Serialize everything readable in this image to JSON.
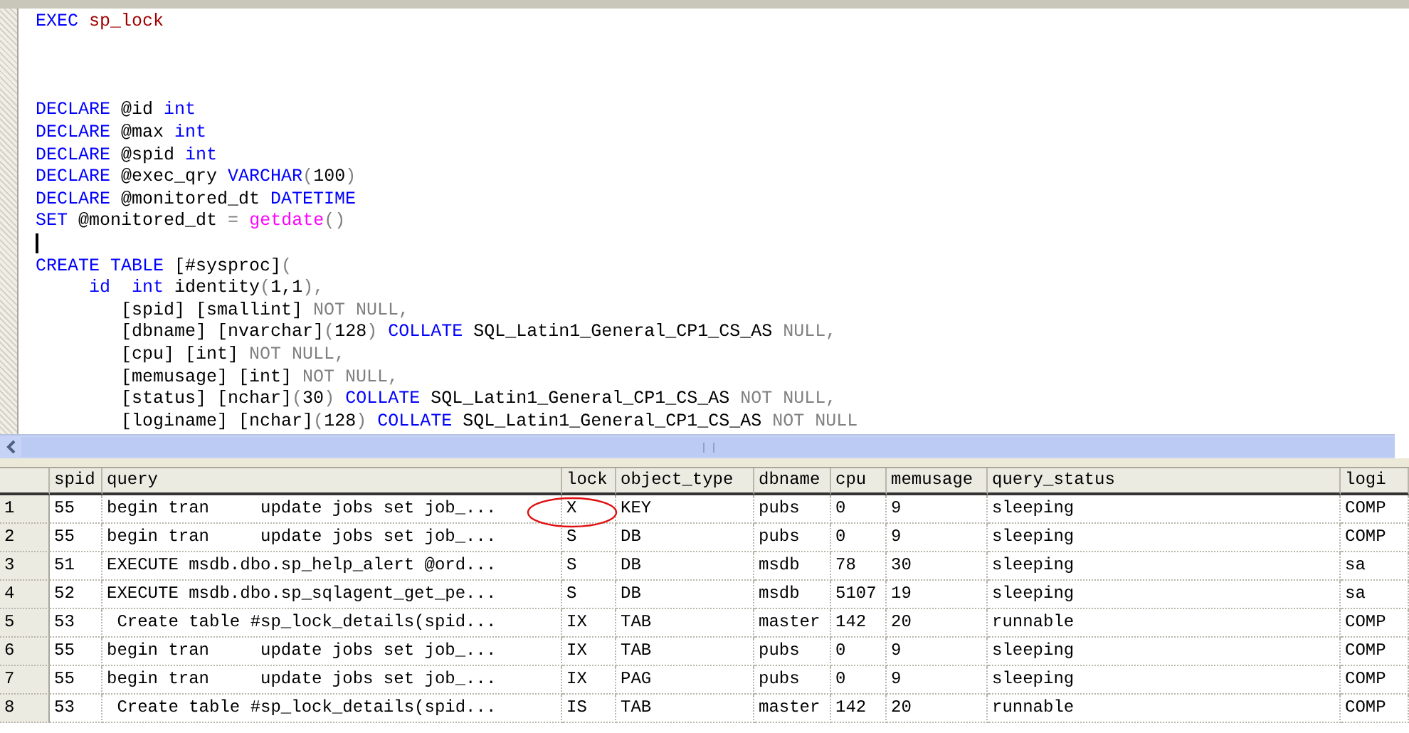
{
  "editor": {
    "lines": [
      {
        "kind": "code",
        "tokens": [
          {
            "kind": "keyword",
            "text": "EXEC "
          },
          {
            "kind": "procedure",
            "text": "sp_lock"
          }
        ]
      },
      {
        "kind": "blank"
      },
      {
        "kind": "blank"
      },
      {
        "kind": "blank"
      },
      {
        "kind": "code",
        "tokens": [
          {
            "kind": "keyword",
            "text": "DECLARE "
          },
          {
            "kind": "plain",
            "text": "@id "
          },
          {
            "kind": "keyword",
            "text": "int"
          }
        ]
      },
      {
        "kind": "code",
        "tokens": [
          {
            "kind": "keyword",
            "text": "DECLARE "
          },
          {
            "kind": "plain",
            "text": "@max "
          },
          {
            "kind": "keyword",
            "text": "int"
          }
        ]
      },
      {
        "kind": "code",
        "tokens": [
          {
            "kind": "keyword",
            "text": "DECLARE "
          },
          {
            "kind": "plain",
            "text": "@spid "
          },
          {
            "kind": "keyword",
            "text": "int"
          }
        ]
      },
      {
        "kind": "code",
        "tokens": [
          {
            "kind": "keyword",
            "text": "DECLARE "
          },
          {
            "kind": "plain",
            "text": "@exec_qry "
          },
          {
            "kind": "keyword",
            "text": "VARCHAR"
          },
          {
            "kind": "operator",
            "text": "("
          },
          {
            "kind": "plain",
            "text": "100"
          },
          {
            "kind": "operator",
            "text": ")"
          }
        ]
      },
      {
        "kind": "code",
        "tokens": [
          {
            "kind": "keyword",
            "text": "DECLARE "
          },
          {
            "kind": "plain",
            "text": "@monitored_dt "
          },
          {
            "kind": "keyword",
            "text": "DATETIME"
          }
        ]
      },
      {
        "kind": "code",
        "tokens": [
          {
            "kind": "keyword",
            "text": "SET "
          },
          {
            "kind": "plain",
            "text": "@monitored_dt "
          },
          {
            "kind": "operator",
            "text": "= "
          },
          {
            "kind": "function",
            "text": "getdate"
          },
          {
            "kind": "operator",
            "text": "()"
          }
        ]
      },
      {
        "kind": "cursor"
      },
      {
        "kind": "code",
        "tokens": [
          {
            "kind": "keyword",
            "text": "CREATE TABLE "
          },
          {
            "kind": "plain",
            "text": "[#sysproc]"
          },
          {
            "kind": "operator",
            "text": "("
          }
        ]
      },
      {
        "kind": "code",
        "tokens": [
          {
            "kind": "keyword",
            "text": "     id  int "
          },
          {
            "kind": "plain",
            "text": "identity"
          },
          {
            "kind": "operator",
            "text": "("
          },
          {
            "kind": "plain",
            "text": "1,1"
          },
          {
            "kind": "operator",
            "text": "),"
          }
        ]
      },
      {
        "kind": "code",
        "tokens": [
          {
            "kind": "plain",
            "text": "        [spid] [smallint] "
          },
          {
            "kind": "operator",
            "text": "NOT NULL,"
          }
        ]
      },
      {
        "kind": "code",
        "tokens": [
          {
            "kind": "plain",
            "text": "        [dbname] [nvarchar]"
          },
          {
            "kind": "operator",
            "text": "("
          },
          {
            "kind": "plain",
            "text": "128"
          },
          {
            "kind": "operator",
            "text": ") "
          },
          {
            "kind": "keyword",
            "text": "COLLATE "
          },
          {
            "kind": "plain",
            "text": "SQL_Latin1_General_CP1_CS_AS "
          },
          {
            "kind": "operator",
            "text": "NULL,"
          }
        ]
      },
      {
        "kind": "code",
        "tokens": [
          {
            "kind": "plain",
            "text": "        [cpu] [int] "
          },
          {
            "kind": "operator",
            "text": "NOT NULL,"
          }
        ]
      },
      {
        "kind": "code",
        "tokens": [
          {
            "kind": "plain",
            "text": "        [memusage] [int] "
          },
          {
            "kind": "operator",
            "text": "NOT NULL,"
          }
        ]
      },
      {
        "kind": "code",
        "tokens": [
          {
            "kind": "plain",
            "text": "        [status] [nchar]"
          },
          {
            "kind": "operator",
            "text": "("
          },
          {
            "kind": "plain",
            "text": "30"
          },
          {
            "kind": "operator",
            "text": ") "
          },
          {
            "kind": "keyword",
            "text": "COLLATE "
          },
          {
            "kind": "plain",
            "text": "SQL_Latin1_General_CP1_CS_AS "
          },
          {
            "kind": "operator",
            "text": "NOT NULL,"
          }
        ]
      },
      {
        "kind": "code",
        "tokens": [
          {
            "kind": "plain",
            "text": "        [loginame] [nchar]"
          },
          {
            "kind": "operator",
            "text": "("
          },
          {
            "kind": "plain",
            "text": "128"
          },
          {
            "kind": "operator",
            "text": ") "
          },
          {
            "kind": "keyword",
            "text": "COLLATE "
          },
          {
            "kind": "plain",
            "text": "SQL_Latin1_General_CP1_CS_AS "
          },
          {
            "kind": "operator",
            "text": "NOT NULL"
          }
        ]
      }
    ]
  },
  "results": {
    "columns": [
      "spid",
      "query",
      "lock",
      "object_type",
      "dbname",
      "cpu",
      "memusage",
      "query_status",
      "logi"
    ],
    "rows": [
      {
        "number": "1",
        "cells": [
          "55",
          "begin tran     update jobs set job_...",
          "X",
          "KEY",
          "pubs",
          "0",
          "9",
          "sleeping",
          "COMP"
        ]
      },
      {
        "number": "2",
        "cells": [
          "55",
          "begin tran     update jobs set job_...",
          "S",
          "DB",
          "pubs",
          "0",
          "9",
          "sleeping",
          "COMP"
        ]
      },
      {
        "number": "3",
        "cells": [
          "51",
          "EXECUTE msdb.dbo.sp_help_alert @ord...",
          "S",
          "DB",
          "msdb",
          "78",
          "30",
          "sleeping",
          "sa"
        ]
      },
      {
        "number": "4",
        "cells": [
          "52",
          "EXECUTE msdb.dbo.sp_sqlagent_get_pe...",
          "S",
          "DB",
          "msdb",
          "5107",
          "19",
          "sleeping",
          "sa"
        ]
      },
      {
        "number": "5",
        "cells": [
          "53",
          " Create table #sp_lock_details(spid...",
          "IX",
          "TAB",
          "master",
          "142",
          "20",
          "runnable",
          "COMP"
        ]
      },
      {
        "number": "6",
        "cells": [
          "55",
          "begin tran     update jobs set job_...",
          "IX",
          "TAB",
          "pubs",
          "0",
          "9",
          "sleeping",
          "COMP"
        ]
      },
      {
        "number": "7",
        "cells": [
          "55",
          "begin tran     update jobs set job_...",
          "IX",
          "PAG",
          "pubs",
          "0",
          "9",
          "sleeping",
          "COMP"
        ]
      },
      {
        "number": "8",
        "cells": [
          "53",
          " Create table #sp_lock_details(spid...",
          "IS",
          "TAB",
          "master",
          "142",
          "20",
          "runnable",
          "COMP"
        ]
      }
    ]
  }
}
